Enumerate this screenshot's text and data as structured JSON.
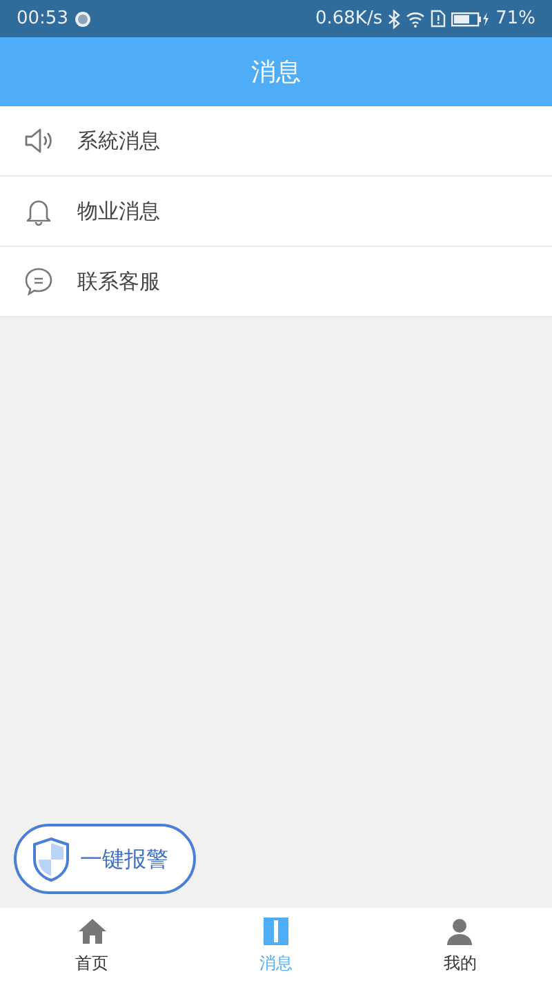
{
  "status_bar": {
    "time": "00:53",
    "speed": "0.68K/s",
    "battery_text": "71%"
  },
  "header": {
    "title": "消息"
  },
  "menu": [
    {
      "kind": "speaker",
      "label": "系統消息"
    },
    {
      "kind": "bell",
      "label": "物业消息"
    },
    {
      "kind": "chat",
      "label": "联系客服"
    }
  ],
  "alarm_button": {
    "label": "一键报警"
  },
  "tabs": [
    {
      "kind": "home",
      "label": "首页",
      "selected": false
    },
    {
      "kind": "message",
      "label": "消息",
      "selected": true
    },
    {
      "kind": "user",
      "label": "我的",
      "selected": false
    }
  ]
}
